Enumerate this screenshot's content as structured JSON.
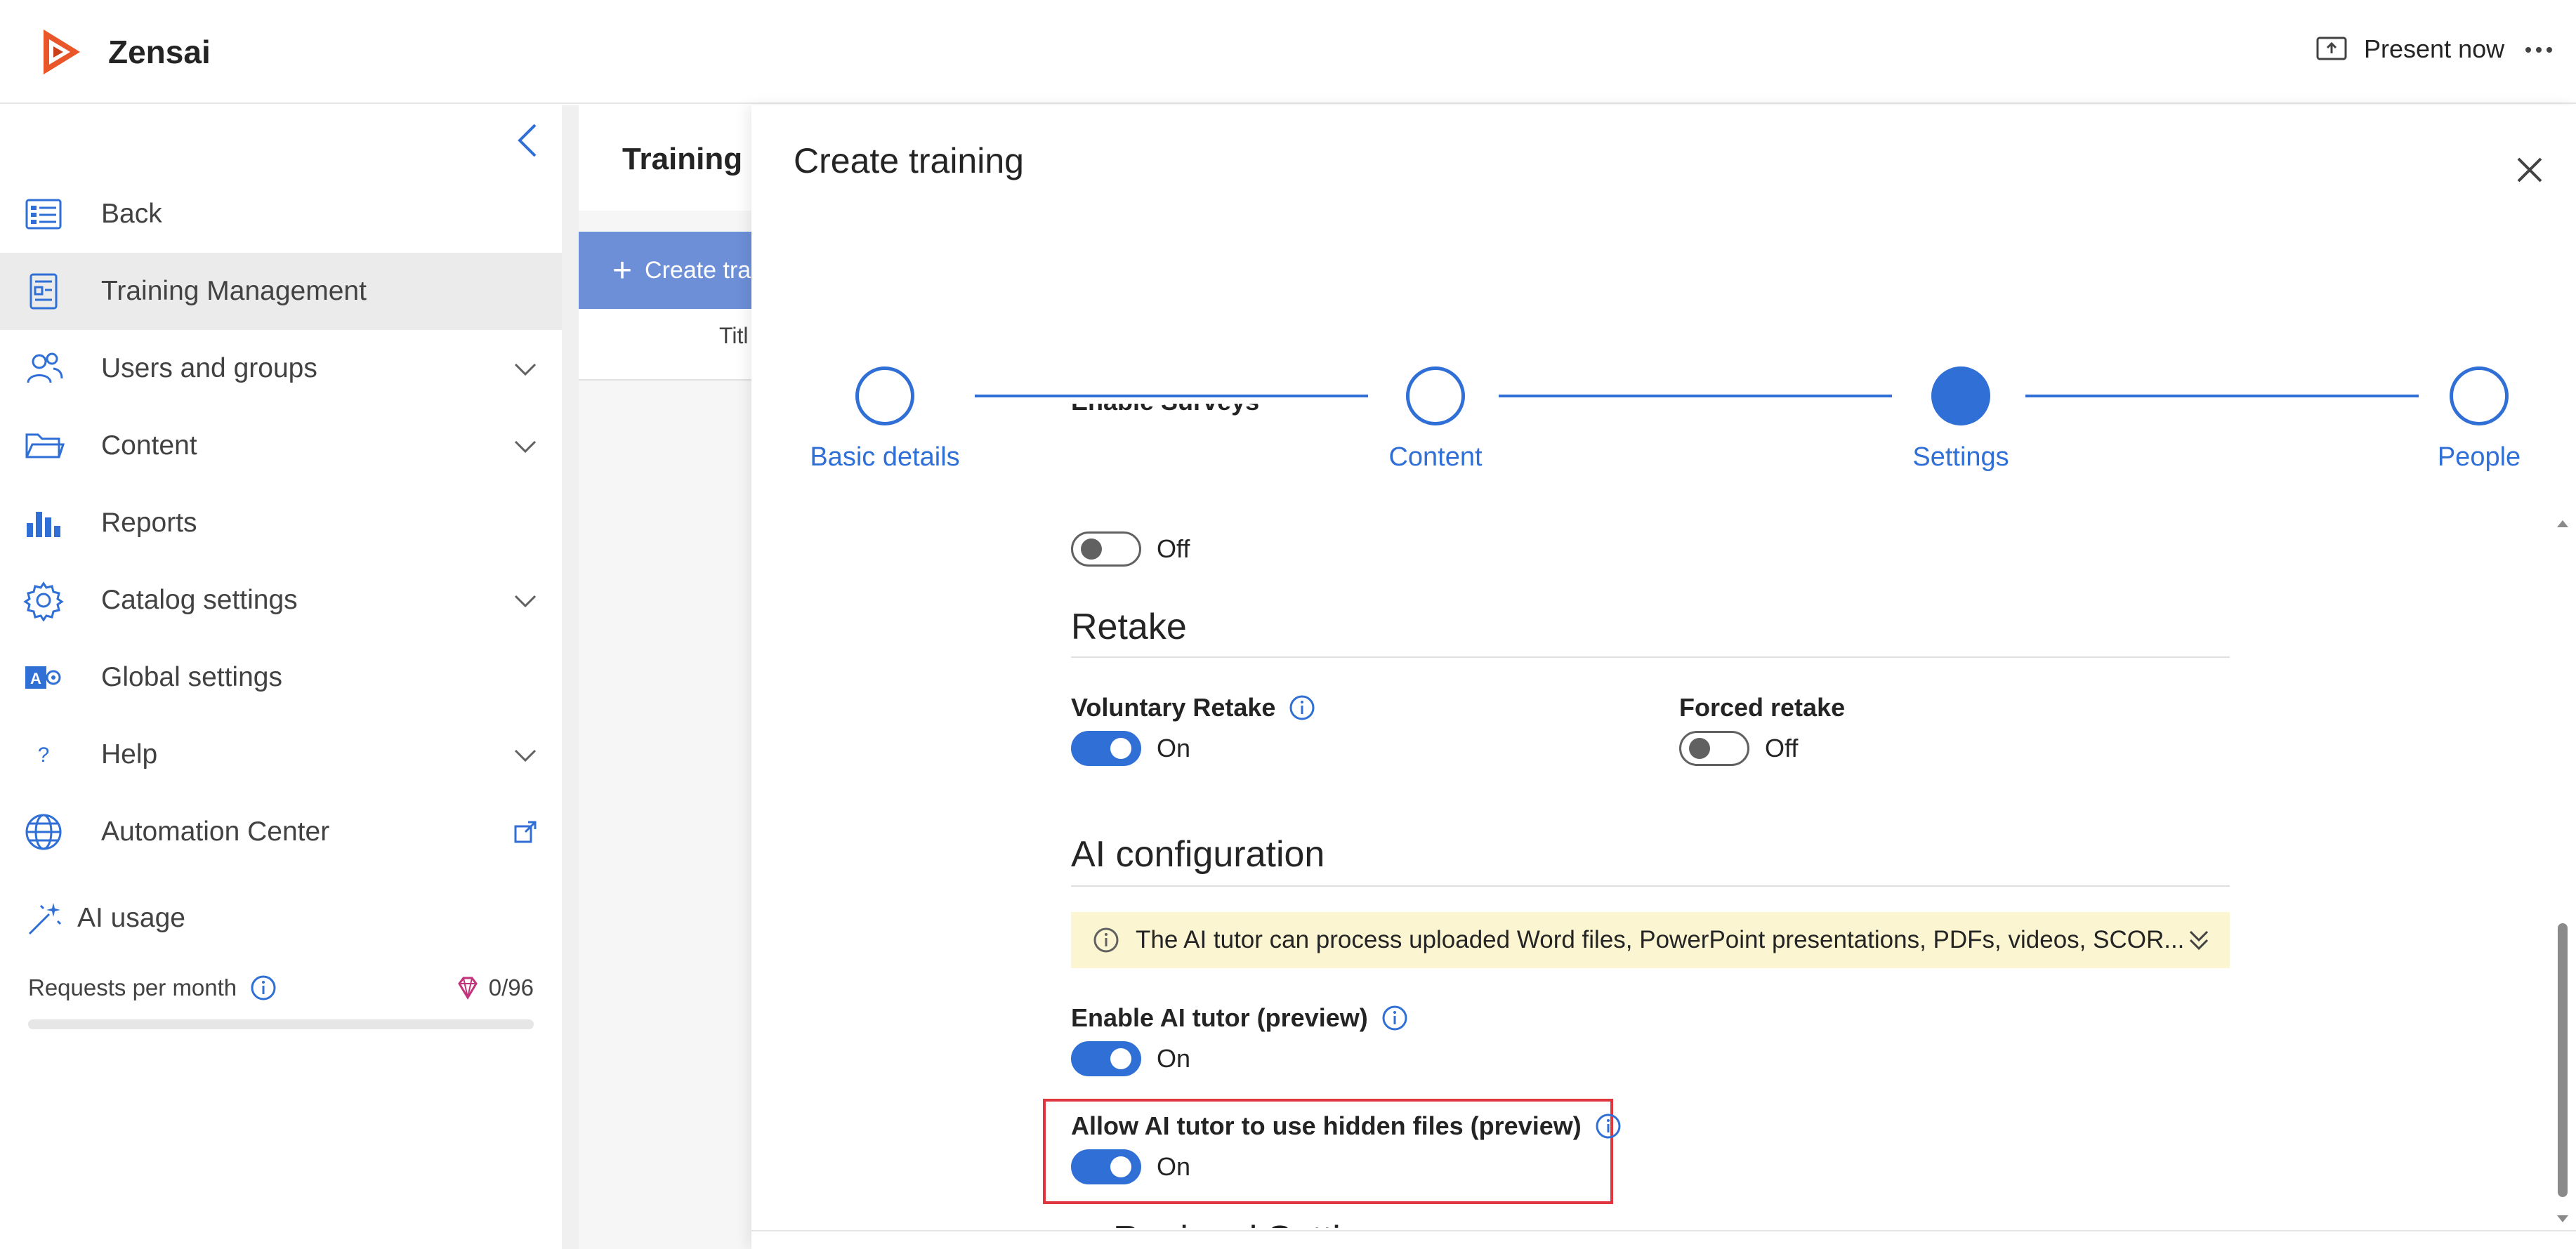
{
  "app": {
    "name": "Zensai"
  },
  "header": {
    "present_label": "Present now"
  },
  "colors": {
    "accent": "#2f6fd6",
    "brand": "#e8562a",
    "banner": "#fbf5d1",
    "highlight": "#e0363d"
  },
  "sidebar": {
    "items": [
      {
        "label": "Back",
        "icon": "list-icon",
        "chevron": false
      },
      {
        "label": "Training Management",
        "icon": "document-icon",
        "chevron": false,
        "active": true
      },
      {
        "label": "Users and groups",
        "icon": "users-icon",
        "chevron": true
      },
      {
        "label": "Content",
        "icon": "folder-icon",
        "chevron": true
      },
      {
        "label": "Reports",
        "icon": "bar-chart-icon",
        "chevron": false
      },
      {
        "label": "Catalog settings",
        "icon": "gear-icon",
        "chevron": true
      },
      {
        "label": "Global settings",
        "icon": "admin-icon",
        "chevron": false
      },
      {
        "label": "Help",
        "icon": "question-icon",
        "chevron": true
      },
      {
        "label": "Automation Center",
        "icon": "globe-icon",
        "chevron": false,
        "external": true
      }
    ],
    "ai_usage": {
      "label": "AI usage",
      "requests_label": "Requests per month",
      "requests_value": "0/96",
      "requests_progress": 0
    }
  },
  "background_page": {
    "title": "Training I",
    "create_label": "Create tra",
    "column": "Titl"
  },
  "dialog": {
    "title": "Create training",
    "steps": [
      {
        "label": "Basic details",
        "state": "pending"
      },
      {
        "label": "Content",
        "state": "pending"
      },
      {
        "label": "Settings",
        "state": "current"
      },
      {
        "label": "People",
        "state": "pending"
      }
    ],
    "surveys": {
      "label": "Enable Surveys",
      "state": "Off"
    },
    "retake": {
      "title": "Retake",
      "voluntary": {
        "label": "Voluntary Retake",
        "state": "On"
      },
      "forced": {
        "label": "Forced retake",
        "state": "Off"
      }
    },
    "ai_config": {
      "title": "AI configuration",
      "banner": "The AI tutor can process uploaded Word files, PowerPoint presentations, PDFs, videos, SCOR...",
      "tutor": {
        "label": "Enable AI tutor (preview)",
        "state": "On"
      },
      "hidden_files": {
        "label": "Allow AI tutor to use hidden files (preview)",
        "state": "On"
      }
    },
    "regional": {
      "title": "Regional Settings"
    }
  }
}
